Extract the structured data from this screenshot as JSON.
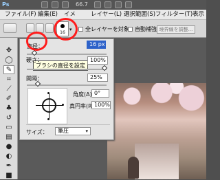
{
  "app": {
    "logo": "Ps",
    "zoom": "66.7",
    "menu": [
      "ファイル(F)",
      "編集(E)",
      "イメ",
      "レイヤー(L)",
      "選択範囲(S)",
      "フィルター(T)",
      "表示"
    ],
    "options": {
      "brush_size": "16",
      "sample_all_layers": "全レイヤーを対象",
      "auto_enhance": "自動補強",
      "refine_edge": "境界線を調整..."
    }
  },
  "panel": {
    "diameter_label": "直径：",
    "diameter_value": "16 px",
    "tooltip": "ブラシの直径を設定",
    "hardness_label": "硬さ：",
    "hardness_value": "100%",
    "spacing_label": "間隔：",
    "spacing_value": "25%",
    "angle_label": "角度(A)：",
    "angle_value": "0°",
    "roundness_label": "真円率(R)：",
    "roundness_value": "100%",
    "size_label": "サイズ：",
    "size_value": "筆圧"
  },
  "tools": [
    "move-tool-icon",
    "lasso-tool-icon",
    "quick-selection-tool-icon",
    "crop-tool-icon",
    "eyedropper-tool-icon",
    "brush-tool-icon",
    "clone-stamp-tool-icon",
    "history-brush-tool-icon",
    "eraser-tool-icon",
    "gradient-tool-icon",
    "blur-tool-icon",
    "dodge-tool-icon",
    "pen-tool-icon",
    "type-tool-icon",
    "path-selection-tool-icon",
    "shape-tool-icon"
  ],
  "colors": {
    "highlight": "#2d62c9",
    "annotation_red": "#ff1b1b"
  }
}
